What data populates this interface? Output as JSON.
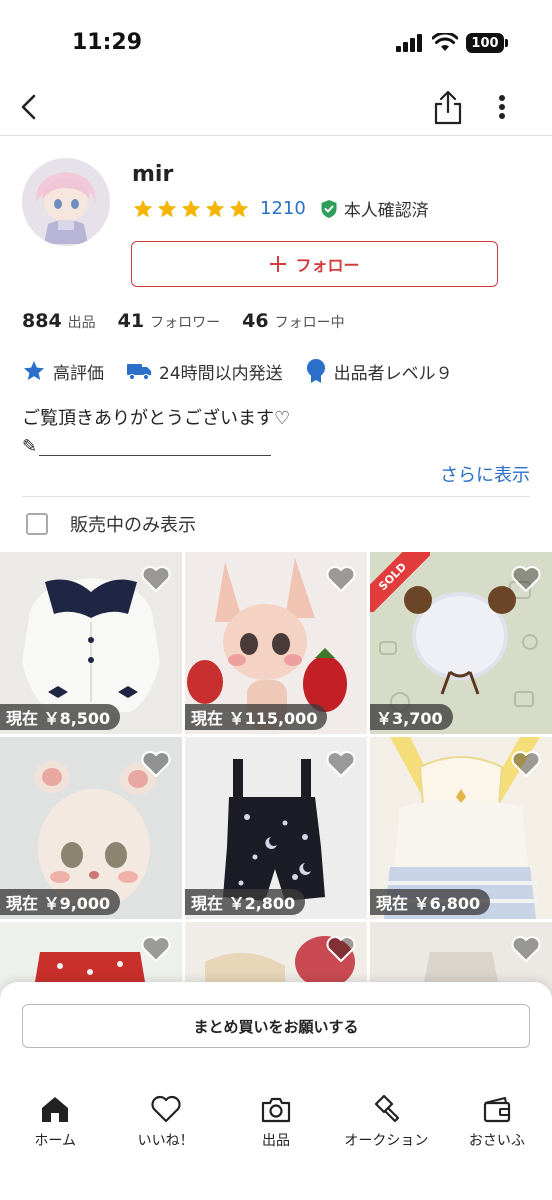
{
  "status_bar": {
    "time": "11:29",
    "battery": "100"
  },
  "profile": {
    "name": "mir",
    "rating_count": "1210",
    "verified_label": "本人確認済",
    "follow_label": "フォロー",
    "star_color": "#f5b400"
  },
  "stats": [
    {
      "num": "884",
      "label": "出品"
    },
    {
      "num": "41",
      "label": "フォロワー"
    },
    {
      "num": "46",
      "label": "フォロー中"
    }
  ],
  "badges": [
    {
      "icon": "star-icon",
      "label": "高評価"
    },
    {
      "icon": "truck-icon",
      "label": "24時間以内発送"
    },
    {
      "icon": "medal-icon",
      "label": "出品者レベル９"
    }
  ],
  "bio": {
    "line1": "ご覧頂きありがとうございます♡",
    "line2_prefix": "✎"
  },
  "show_more": "さらに表示",
  "filter_label": "販売中のみ表示",
  "items": [
    {
      "price": "現在 ￥8,500"
    },
    {
      "price": "現在 ￥115,000"
    },
    {
      "price": "￥3,700",
      "sold": "SOLD"
    },
    {
      "price": "現在 ￥9,000"
    },
    {
      "price": "現在 ￥2,800"
    },
    {
      "price": "現在 ￥6,800"
    }
  ],
  "bulk_button": "まとめ買いをお願いする",
  "tabs": [
    {
      "icon": "home-icon",
      "label": "ホーム"
    },
    {
      "icon": "heart-icon",
      "label": "いいね！"
    },
    {
      "icon": "camera-icon",
      "label": "出品"
    },
    {
      "icon": "gavel-icon",
      "label": "オークション"
    },
    {
      "icon": "wallet-icon",
      "label": "おさいふ"
    }
  ],
  "colors": {
    "accent_red": "#d23d3d",
    "link_blue": "#2a6fc9",
    "verified_green": "#2e9e5b"
  }
}
